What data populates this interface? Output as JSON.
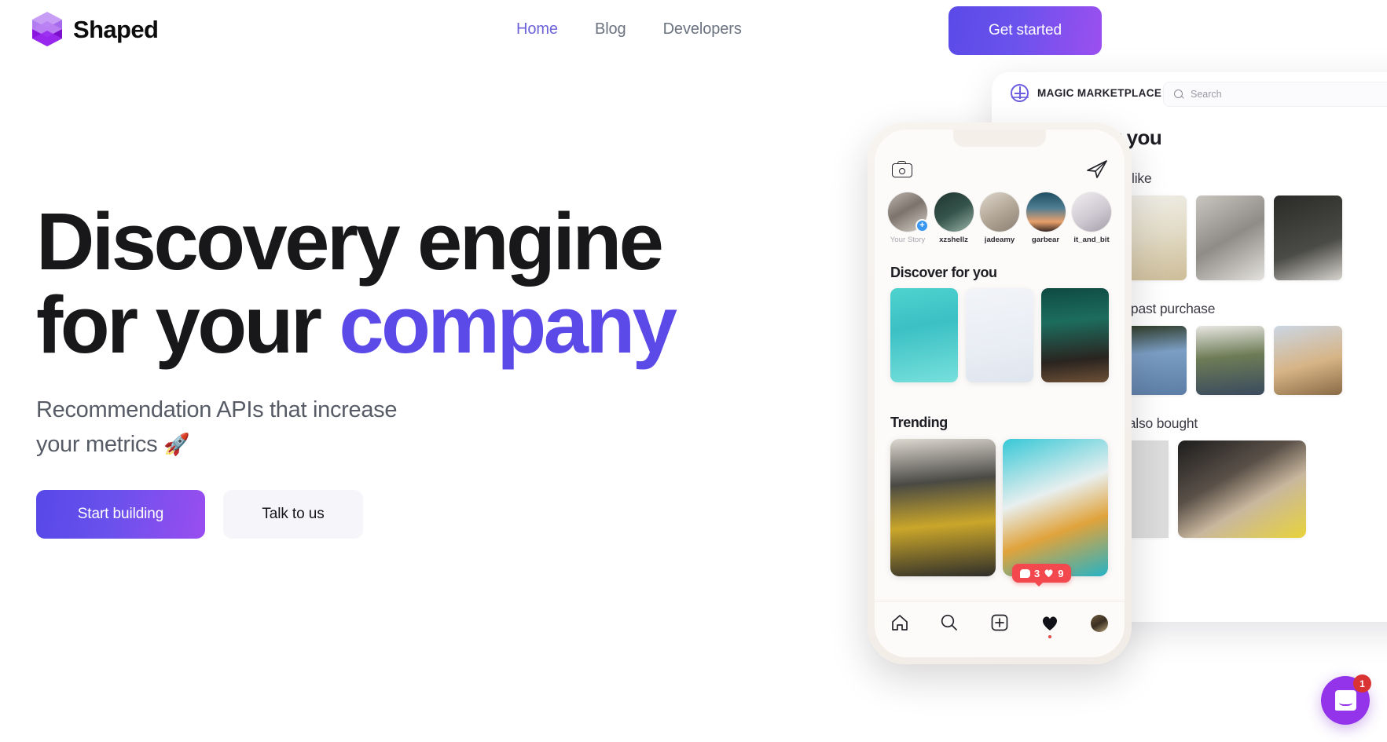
{
  "brand": {
    "name": "Shaped",
    "logo_icon": "stacked-cube-logo",
    "colors": {
      "logo_light": "#c08ef0",
      "logo_mid": "#a855f7",
      "logo_dark": "#8b19e8"
    }
  },
  "nav": {
    "links": [
      {
        "label": "Home",
        "active": true
      },
      {
        "label": "Blog",
        "active": false
      },
      {
        "label": "Developers",
        "active": false
      }
    ],
    "cta": {
      "label": "Get started"
    }
  },
  "hero": {
    "headline_line1": "Discovery engine",
    "headline_line2_plain": "for your ",
    "headline_line2_accent": "company",
    "subhead_line1": "Recommendation APIs that increase",
    "subhead_line2": "your metrics ",
    "subhead_emoji": "🚀",
    "primary_cta": "Start building",
    "secondary_cta": "Talk to us"
  },
  "phone": {
    "icons": {
      "camera": "camera-icon",
      "send": "paper-plane-icon"
    },
    "stories": [
      {
        "name": "Your Story",
        "muted": true,
        "has_plus": true
      },
      {
        "name": "xzshellz",
        "muted": false,
        "has_plus": false
      },
      {
        "name": "jadeamy",
        "muted": false,
        "has_plus": false
      },
      {
        "name": "garbear",
        "muted": false,
        "has_plus": false
      },
      {
        "name": "it_and_bit",
        "muted": false,
        "has_plus": false
      }
    ],
    "discover_title": "Discover for you",
    "trending_title": "Trending",
    "engagement": {
      "comments": "3",
      "likes": "9"
    },
    "bottom_nav": [
      {
        "icon": "home-icon",
        "active": false
      },
      {
        "icon": "search-icon",
        "active": false
      },
      {
        "icon": "add-post-icon",
        "active": false
      },
      {
        "icon": "heart-icon",
        "active": true
      },
      {
        "icon": "profile-avatar-icon",
        "active": false
      }
    ]
  },
  "marketplace": {
    "logo_icon": "peace-sign-icon",
    "title": "MAGIC MARKETPLACE",
    "search_placeholder": "Search",
    "heading": "Shop for you",
    "sections": [
      {
        "title": "You might also like",
        "count": 4
      },
      {
        "title": "Based on your past purchase",
        "count": 4
      },
      {
        "title": "Users like you also bought",
        "count": 2
      }
    ]
  },
  "chat": {
    "icon": "chat-bubble-icon",
    "badge": "1"
  },
  "theme": {
    "accent_purple": "#5b4ae8",
    "nav_active": "#6d63d8",
    "text_dark": "#18181b",
    "text_muted": "#565b66",
    "gradient_start": "#5748e9",
    "gradient_end": "#9a4df0",
    "chat_purple": "#9333ea",
    "badge_red": "#d93333"
  }
}
